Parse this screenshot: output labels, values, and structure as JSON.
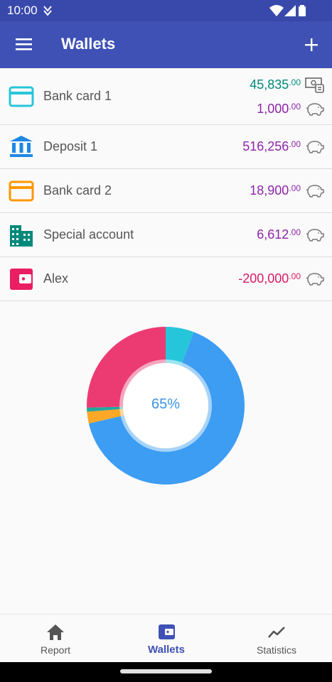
{
  "status_bar": {
    "time": "10:00"
  },
  "app_bar": {
    "title": "Wallets",
    "menu_icon": "menu-icon",
    "add_icon": "add-icon"
  },
  "wallets": [
    {
      "name": "Bank card 1",
      "icon": "credit-card-icon",
      "icon_color": "#26c6da",
      "amounts": [
        {
          "int": "45,835",
          "dec": ".00",
          "color": "#00897b",
          "icon": "cash-icon"
        },
        {
          "int": "1,000",
          "dec": ".00",
          "color": "#8e24aa",
          "icon": "piggy-bank-icon"
        }
      ]
    },
    {
      "name": "Deposit 1",
      "icon": "bank-icon",
      "icon_color": "#1e88e5",
      "amounts": [
        {
          "int": "516,256",
          "dec": ".00",
          "color": "#8e24aa",
          "icon": "piggy-bank-icon"
        }
      ]
    },
    {
      "name": "Bank card 2",
      "icon": "credit-card-icon",
      "icon_color": "#ff9800",
      "amounts": [
        {
          "int": "18,900",
          "dec": ".00",
          "color": "#8e24aa",
          "icon": "piggy-bank-icon"
        }
      ]
    },
    {
      "name": "Special account",
      "icon": "building-icon",
      "icon_color": "#00897b",
      "amounts": [
        {
          "int": "6,612",
          "dec": ".00",
          "color": "#8e24aa",
          "icon": "piggy-bank-icon"
        }
      ]
    },
    {
      "name": "Alex",
      "icon": "wallet-icon",
      "icon_color": "#e91e63",
      "amounts": [
        {
          "int": "-200,000",
          "dec": ".00",
          "color": "#d81b60",
          "icon": "piggy-bank-icon"
        }
      ]
    }
  ],
  "chart_data": {
    "type": "pie",
    "center_label": "65%",
    "slices": [
      {
        "label": "Bank card 1",
        "value": 45835,
        "color": "#26c6da"
      },
      {
        "label": "Deposit 1",
        "value": 516256,
        "color": "#3d9df2"
      },
      {
        "label": "Bank card 2",
        "value": 18900,
        "color": "#ffa726"
      },
      {
        "label": "Special account",
        "value": 6612,
        "color": "#26a69a"
      },
      {
        "label": "Alex",
        "value": 200000,
        "color": "#ec3b72"
      }
    ]
  },
  "bottom_nav": [
    {
      "label": "Report",
      "icon": "home-icon",
      "active": false
    },
    {
      "label": "Wallets",
      "icon": "wallet-icon",
      "active": true
    },
    {
      "label": "Statistics",
      "icon": "trending-icon",
      "active": false
    }
  ],
  "colors": {
    "primary": "#3f51b5",
    "status_bar": "#3949ab",
    "accent_text": "#3a93e6"
  }
}
